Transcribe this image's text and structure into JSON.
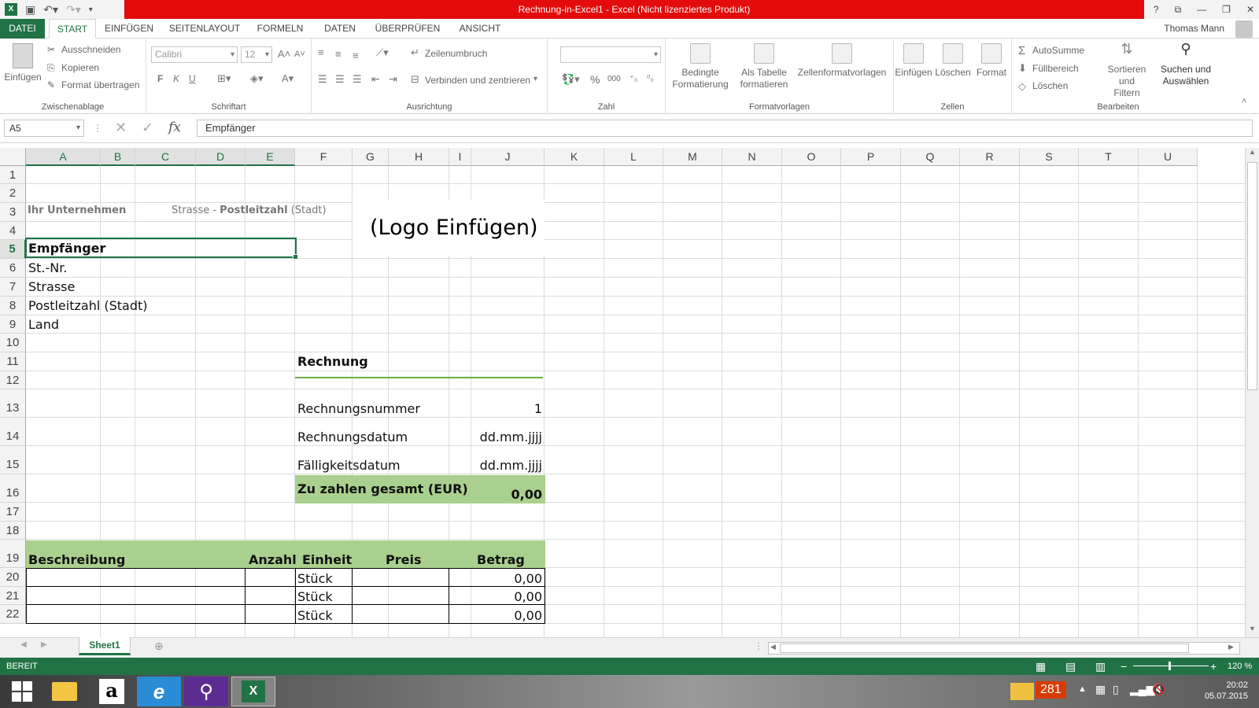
{
  "window": {
    "title": "Rechnung-in-Excel1 -  Excel (Nicht lizenziertes Produkt)",
    "help": "?",
    "user": "Thomas Mann"
  },
  "tabs": [
    "DATEI",
    "START",
    "EINFÜGEN",
    "SEITENLAYOUT",
    "FORMELN",
    "DATEN",
    "ÜBERPRÜFEN",
    "ANSICHT"
  ],
  "ribbon": {
    "clipboard": {
      "paste": "Einfügen",
      "cut": "Ausschneiden",
      "copy": "Kopieren",
      "format_painter": "Format übertragen",
      "label": "Zwischenablage"
    },
    "font": {
      "name": "Calibri",
      "size": "12",
      "bold": "F",
      "italic": "K",
      "underline": "U",
      "label": "Schriftart"
    },
    "alignment": {
      "wrap": "Zeilenumbruch",
      "merge": "Verbinden und zentrieren",
      "label": "Ausrichtung"
    },
    "number": {
      "percent": "%",
      "thousands": "000",
      "label": "Zahl"
    },
    "styles": {
      "conditional_1": "Bedingte",
      "conditional_2": "Formatierung",
      "as_table_1": "Als Tabelle",
      "as_table_2": "formatieren",
      "cell_styles": "Zellenformatvorlagen",
      "label": "Formatvorlagen"
    },
    "cells": {
      "insert": "Einfügen",
      "delete": "Löschen",
      "format": "Format",
      "label": "Zellen"
    },
    "editing": {
      "autosum": "AutoSumme",
      "fill": "Füllbereich",
      "clear": "Löschen",
      "sort_1": "Sortieren und",
      "sort_2": "Filtern",
      "find_1": "Suchen und",
      "find_2": "Auswählen",
      "label": "Bearbeiten"
    }
  },
  "formula_bar": {
    "name_box": "A5",
    "fx": "fx",
    "content": "Empfänger"
  },
  "columns": [
    "A",
    "B",
    "C",
    "D",
    "E",
    "F",
    "G",
    "H",
    "I",
    "J",
    "K",
    "L",
    "M",
    "N",
    "O",
    "P",
    "Q",
    "R",
    "S",
    "T",
    "U"
  ],
  "rows": [
    "1",
    "2",
    "3",
    "4",
    "5",
    "6",
    "7",
    "8",
    "9",
    "10",
    "11",
    "12",
    "13",
    "14",
    "15",
    "16",
    "17",
    "18",
    "19",
    "20",
    "21",
    "22"
  ],
  "sheet": {
    "company": "Ihr Unternehmen",
    "address_street": "Strasse -",
    "address_zip": "Postleitzahl",
    "address_city": "(Stadt)",
    "logo": "(Logo Einfügen)",
    "recipient": {
      "title": "Empfänger",
      "no": "St.-Nr.",
      "street": "Strasse",
      "zip_city": "Postleitzahl (Stadt)",
      "country": "Land"
    },
    "invoice": {
      "title": "Rechnung",
      "number_label": "Rechnungsnummer",
      "number_value": "1",
      "date_label": "Rechnungsdatum",
      "date_value": "dd.mm.jjjj",
      "due_label": "Fälligkeitsdatum",
      "due_value": "dd.mm.jjjj",
      "total_label": "Zu zahlen gesamt (EUR)",
      "total_value": "0,00"
    },
    "table": {
      "headers": {
        "desc": "Beschreibung",
        "qty": "Anzahl",
        "unit": "Einheit",
        "price": "Preis",
        "amount": "Betrag"
      },
      "rows": [
        {
          "unit": "Stück",
          "amount": "0,00"
        },
        {
          "unit": "Stück",
          "amount": "0,00"
        },
        {
          "unit": "Stück",
          "amount": "0,00"
        }
      ]
    }
  },
  "sheet_tabs": [
    "Sheet1"
  ],
  "status": {
    "mode": "BEREIT",
    "zoom": "120 %"
  },
  "taskbar": {
    "mail_count": "281",
    "time": "20:02",
    "date": "05.07.2015"
  },
  "colors": {
    "excel_green": "#217346",
    "title_red": "#e30b0b",
    "fill_green": "#a9d08e"
  }
}
